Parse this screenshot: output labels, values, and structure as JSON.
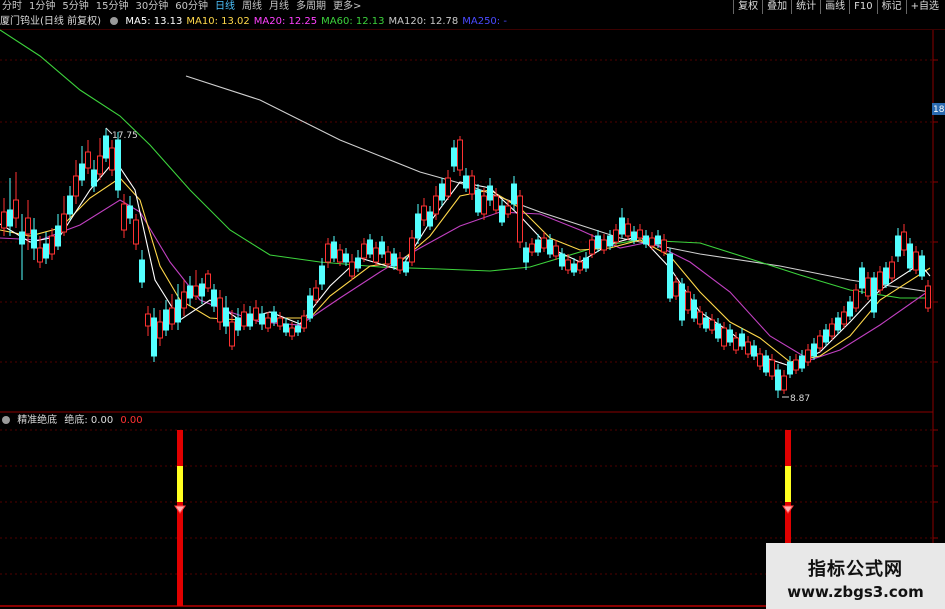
{
  "toolbar": {
    "periods": [
      "分时",
      "1分钟",
      "5分钟",
      "15分钟",
      "30分钟",
      "60分钟",
      "日线",
      "周线",
      "月线",
      "多周期",
      "更多>"
    ],
    "active_period": "日线",
    "right_buttons": [
      "复权",
      "叠加",
      "统计",
      "画线",
      "F10",
      "标记",
      "+自选"
    ]
  },
  "infobar": {
    "stock": "厦门钨业(日线 前复权)",
    "ma": [
      {
        "label": "MA5: 13.13",
        "color": "#ffffff"
      },
      {
        "label": "MA10: 13.02",
        "color": "#ffd84a"
      },
      {
        "label": "MA20: 12.25",
        "color": "#ff40ff"
      },
      {
        "label": "MA60: 12.13",
        "color": "#3cd23c"
      },
      {
        "label": "MA120: 12.78",
        "color": "#c8c8c8"
      },
      {
        "label": "MA250: -",
        "color": "#4a4aff"
      }
    ]
  },
  "price_labels": {
    "high": "17.75",
    "low": "8.87",
    "side": "18"
  },
  "indicator": {
    "name": "精准绝底",
    "label": "绝底: 0.00",
    "value": "0.00"
  },
  "watermark": {
    "line1": "指标公式网",
    "line2": "www.zbgs3.com"
  },
  "colors": {
    "up": "#ff3232",
    "down": "#54ffff",
    "ma5": "#ffffff",
    "ma10": "#ffd84a",
    "ma20": "#c040c0",
    "ma60": "#3cd23c",
    "ma120": "#d0d0d0",
    "grid": "#500000"
  }
}
